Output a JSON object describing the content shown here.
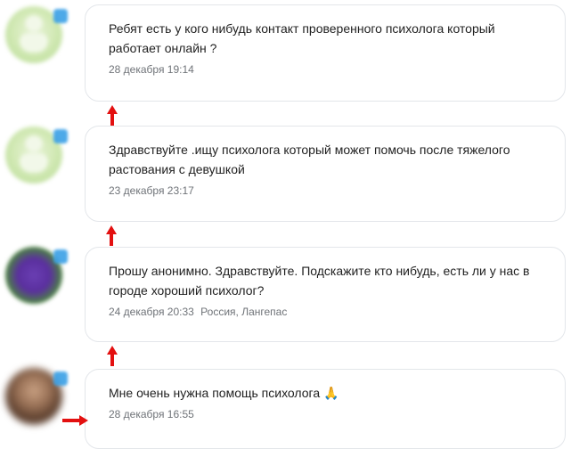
{
  "accent_arrow_color": "#e31010",
  "posts": [
    {
      "avatar": "green-placeholder-avatar",
      "text": "Ребят есть у кого нибудь контакт проверенного психолога который работает онлайн ?",
      "date": "28 декабря 19:14",
      "location": ""
    },
    {
      "avatar": "green-placeholder-avatar",
      "text": "Здравствуйте .ищу психолога который может помочь после тяжелого растования с девушкой",
      "date": "23 декабря 23:17",
      "location": ""
    },
    {
      "avatar": "purple-logo-avatar",
      "text": "Прошу анонимно. Здравствуйте. Подскажите кто нибудь, есть ли у нас в городе хороший психолог?",
      "date": "24 декабря 20:33",
      "location": "Россия, Лангепас"
    },
    {
      "avatar": "photo-avatar",
      "text": "Мне очень нужна помощь психолога",
      "emoji": "🙏",
      "date": "28 декабря 16:55",
      "location": ""
    }
  ]
}
